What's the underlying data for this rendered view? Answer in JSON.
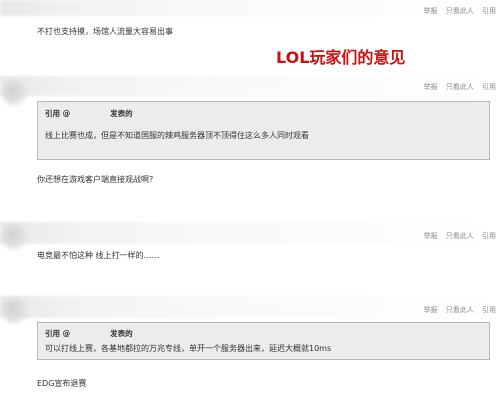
{
  "overlay_title": "LOL玩家们的意见",
  "actions": {
    "report": "举报",
    "quote": "只看此人",
    "reply": "引用"
  },
  "posts": [
    {
      "text": "不打也支持摸，场馆人流量大容易出事"
    },
    {
      "quote": {
        "label": "引用 @",
        "posted": "发表的",
        "body": "线上比赛也成，但是不知道国服的辣鸡服务器顶不顶得住这么多人同时观看"
      },
      "text": "你还想在游戏客户端直接观战啊?"
    },
    {
      "text": "电竞最不怕这种 线上打一样的……"
    },
    {
      "quote": {
        "label": "引用 @",
        "posted": "发表的",
        "body": "可以打线上赛，各基地都拉的万兆专线，单开一个服务器出来，延迟大概就10ms"
      },
      "text": "EDG宣布退赛"
    }
  ]
}
